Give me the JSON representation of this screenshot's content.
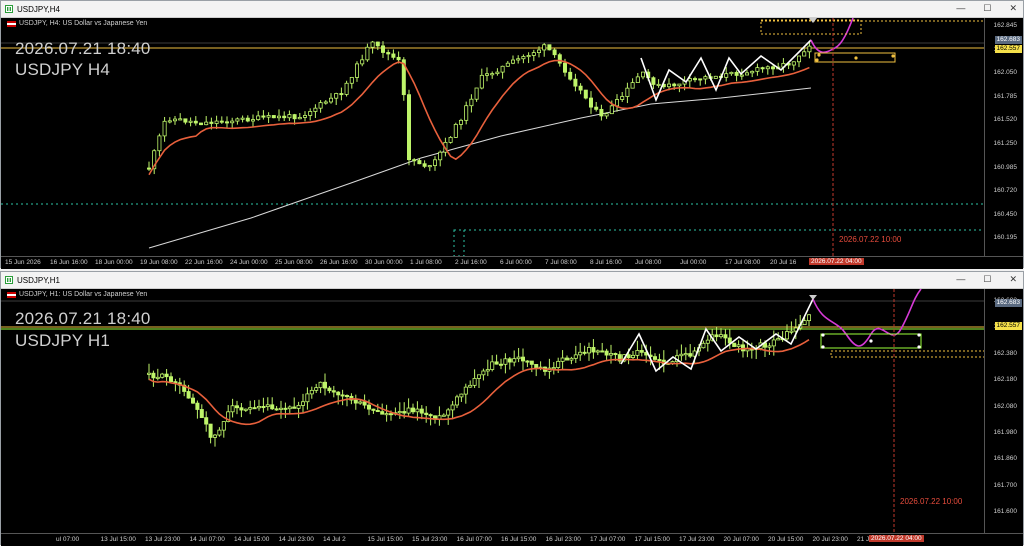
{
  "h4": {
    "window_title": "USDJPY,H4",
    "info": "USDJPY, H4:  US Dollar vs Japanese Yen",
    "overlay_datetime": "2026.07.21 18:40",
    "overlay_symbol": "USDJPY H4",
    "price_labels": [
      "162.845",
      "162.315",
      "162.050",
      "161.785",
      "161.520",
      "161.250",
      "160.985",
      "160.720",
      "160.450",
      "160.195"
    ],
    "tag_top": "162.683",
    "tag_current": "162.557",
    "time_labels": [
      "15 Jun 2026",
      "16 Jun 16:00",
      "18 Jun 00:00",
      "19 Jun 08:00",
      "22 Jun 16:00",
      "24 Jun 00:00",
      "25 Jun 08:00",
      "26 Jun 16:00",
      "30 Jun 00:00",
      "1 Jul 08:00",
      "2 Jul 16:00",
      "6 Jul 00:00",
      "7 Jul 08:00",
      "8 Jul 16:00",
      "Jul 08:00",
      "Jul 00:00",
      "17 Jul 08:00",
      "20 Jul 16"
    ],
    "time_tag": "2026.07.22 04:00",
    "vline_text": "2026.07.22 10:00",
    "price_min": 160.1,
    "price_max": 162.95
  },
  "h1": {
    "window_title": "USDJPY,H1",
    "info": "USDJPY, H1:  US Dollar vs Japanese Yen",
    "overlay_datetime": "2026.07.21 18:40",
    "overlay_symbol": "USDJPY H1",
    "price_labels": [
      "162.683",
      "162.400",
      "162.380",
      "162.180",
      "162.080",
      "161.980",
      "161.860",
      "161.700",
      "161.600"
    ],
    "tag_top": "162.683",
    "tag_current": "162.557",
    "time_labels": [
      "ul 07:00",
      "13 Jul 15:00",
      "13 Jul 23:00",
      "14 Jul 07:00",
      "14 Jul 15:00",
      "14 Jul 23:00",
      "14 Jul 2",
      "15 Jul 15:00",
      "15 Jul 23:00",
      "16 Jul 07:00",
      "16 Jul 15:00",
      "16 Jul 23:00",
      "17 Jul 07:00",
      "17 Jul 15:00",
      "17 Jul 23:00",
      "20 Jul 07:00",
      "20 Jul 15:00",
      "20 Jul 23:00",
      "21 Jul 07:00"
    ],
    "time_tag": "2026.07.22 04:00",
    "vline_text": "2026.07.22 10:00",
    "price_min": 161.55,
    "price_max": 162.72
  },
  "colors": {
    "bull": "#bff56a",
    "bear": "#bff56a",
    "ma_fast": "#e8603c",
    "ma_slow": "#d9d9d9",
    "zigzag": "#ffffff",
    "projection": "#d63ad6",
    "level": "#f0c040",
    "lime_level": "#9bff3a",
    "cyan_dots": "#2ec4a6",
    "vline": "#c0392b"
  },
  "icons": {
    "app": "chart-window-icon",
    "minimize": "minimize-icon",
    "maximize": "maximize-icon",
    "close": "close-icon"
  }
}
